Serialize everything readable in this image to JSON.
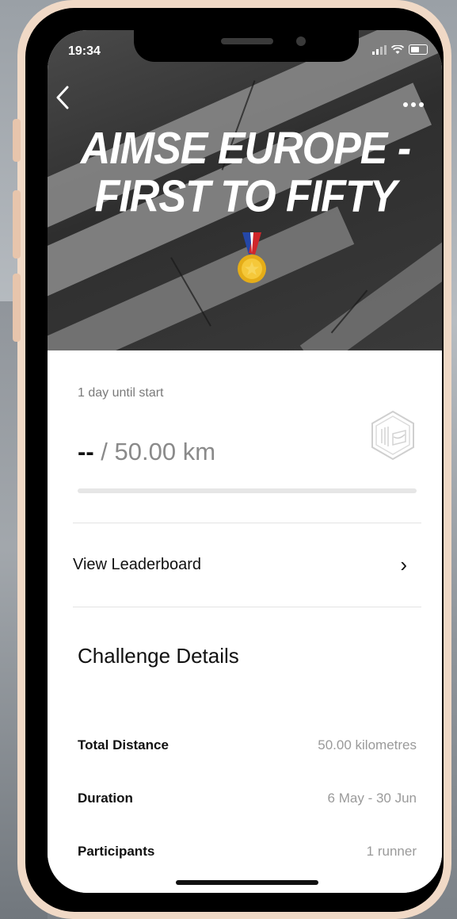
{
  "status_bar": {
    "time": "19:34"
  },
  "header": {
    "title_line1": "AIMSE EUROPE -",
    "title_line2": "FIRST TO FIFTY"
  },
  "challenge": {
    "until_start": "1 day until start",
    "progress_current": "--",
    "progress_target": "/ 50.00 km",
    "progress_fraction": 0
  },
  "leaderboard": {
    "label": "View Leaderboard",
    "chevron": "›"
  },
  "details": {
    "title": "Challenge Details",
    "rows": [
      {
        "label": "Total Distance",
        "value": "50.00 kilometres"
      },
      {
        "label": "Duration",
        "value": "6 May - 30 Jun"
      },
      {
        "label": "Participants",
        "value": "1 runner"
      }
    ]
  },
  "icons": {
    "back": "back-icon",
    "more": "more-icon",
    "medal": "medal-icon",
    "badge": "nike-badge-icon",
    "signal": "signal-icon",
    "wifi": "wifi-icon",
    "battery": "battery-icon"
  },
  "colors": {
    "accent": "#111111",
    "muted_text": "#9a9a9a",
    "phone_frame": "#f0d9c6"
  }
}
